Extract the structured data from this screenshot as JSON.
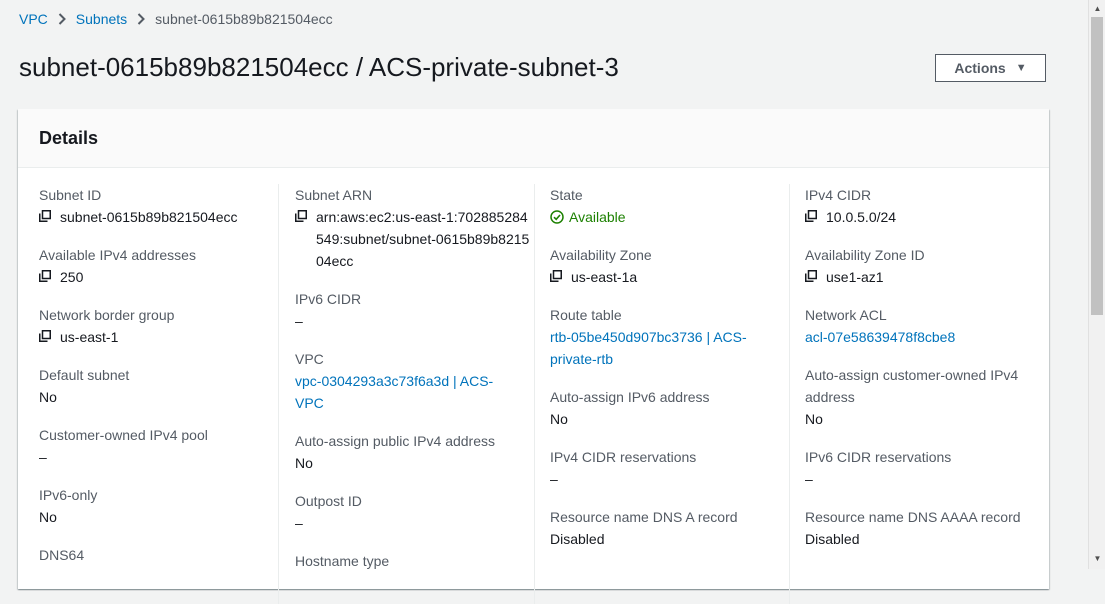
{
  "breadcrumb": {
    "items": [
      "VPC",
      "Subnets"
    ],
    "current": "subnet-0615b89b821504ecc"
  },
  "page_title": "subnet-0615b89b821504ecc / ACS-private-subnet-3",
  "actions_label": "Actions",
  "details": {
    "title": "Details",
    "subnet_id": {
      "label": "Subnet ID",
      "value": "subnet-0615b89b821504ecc"
    },
    "available_ipv4": {
      "label": "Available IPv4 addresses",
      "value": "250"
    },
    "network_border_group": {
      "label": "Network border group",
      "value": "us-east-1"
    },
    "default_subnet": {
      "label": "Default subnet",
      "value": "No"
    },
    "customer_owned_ipv4_pool": {
      "label": "Customer-owned IPv4 pool",
      "value": "–"
    },
    "ipv6_only": {
      "label": "IPv6-only",
      "value": "No"
    },
    "dns64": {
      "label": "DNS64"
    },
    "subnet_arn": {
      "label": "Subnet ARN",
      "value": "arn:aws:ec2:us-east-1:702885284549:subnet/subnet-0615b89b821504ecc"
    },
    "ipv6_cidr": {
      "label": "IPv6 CIDR",
      "value": "–"
    },
    "vpc": {
      "label": "VPC",
      "value": "vpc-0304293a3c73f6a3d | ACS-VPC"
    },
    "auto_assign_public_ipv4": {
      "label": "Auto-assign public IPv4 address",
      "value": "No"
    },
    "outpost_id": {
      "label": "Outpost ID",
      "value": "–"
    },
    "hostname_type": {
      "label": "Hostname type"
    },
    "state": {
      "label": "State",
      "value": "Available"
    },
    "availability_zone": {
      "label": "Availability Zone",
      "value": "us-east-1a"
    },
    "route_table": {
      "label": "Route table",
      "value": "rtb-05be450d907bc3736 | ACS-private-rtb"
    },
    "auto_assign_ipv6": {
      "label": "Auto-assign IPv6 address",
      "value": "No"
    },
    "ipv4_cidr_reservations": {
      "label": "IPv4 CIDR reservations",
      "value": "–"
    },
    "dns_a_record": {
      "label": "Resource name DNS A record",
      "value": "Disabled"
    },
    "ipv4_cidr": {
      "label": "IPv4 CIDR",
      "value": "10.0.5.0/24"
    },
    "availability_zone_id": {
      "label": "Availability Zone ID",
      "value": "use1-az1"
    },
    "network_acl": {
      "label": "Network ACL",
      "value": "acl-07e58639478f8cbe8"
    },
    "auto_assign_customer_owned_ipv4": {
      "label": "Auto-assign customer-owned IPv4 address",
      "value": "No"
    },
    "ipv6_cidr_reservations": {
      "label": "IPv6 CIDR reservations",
      "value": "–"
    },
    "dns_aaaa_record": {
      "label": "Resource name DNS AAAA record",
      "value": "Disabled"
    }
  },
  "icons": {
    "copy": "copy-icon",
    "status": "check-circle-icon",
    "separator": "chevron-right-icon",
    "dropdown": "caret-down-icon"
  },
  "colors": {
    "link": "#0073bb",
    "success": "#1d8102",
    "text": "#16191f",
    "label": "#545b64",
    "background": "#f2f3f3"
  }
}
